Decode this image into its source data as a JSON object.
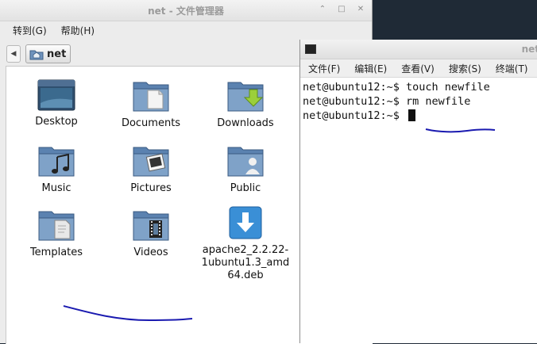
{
  "file_manager": {
    "title": "net - 文件管理器",
    "menu": [
      "转到(G)",
      "帮助(H)"
    ],
    "path_label": "net",
    "items": [
      {
        "label": "Desktop",
        "icon": "desktop-icon"
      },
      {
        "label": "Documents",
        "icon": "documents-folder-icon"
      },
      {
        "label": "Downloads",
        "icon": "downloads-folder-icon"
      },
      {
        "label": "Music",
        "icon": "music-folder-icon"
      },
      {
        "label": "Pictures",
        "icon": "pictures-folder-icon"
      },
      {
        "label": "Public",
        "icon": "public-folder-icon"
      },
      {
        "label": "Templates",
        "icon": "templates-folder-icon"
      },
      {
        "label": "Videos",
        "icon": "videos-folder-icon"
      },
      {
        "label": "apache2_2.2.22-\n1ubuntu1.3_amd\n64.deb",
        "icon": "deb-package-icon"
      }
    ],
    "window_buttons": [
      "minimize-icon",
      "maximize-icon",
      "close-icon"
    ]
  },
  "terminal": {
    "title": "net",
    "menu": [
      "文件(F)",
      "编辑(E)",
      "查看(V)",
      "搜索(S)",
      "终端(T)"
    ],
    "lines": [
      "net@ubuntu12:~$ touch newfile",
      "net@ubuntu12:~$ rm newfile",
      "net@ubuntu12:~$ "
    ]
  },
  "colors": {
    "folder_blue": "#5b82b0",
    "scribble": "#1a1ab0",
    "download_arrow": "#8cc63f"
  }
}
